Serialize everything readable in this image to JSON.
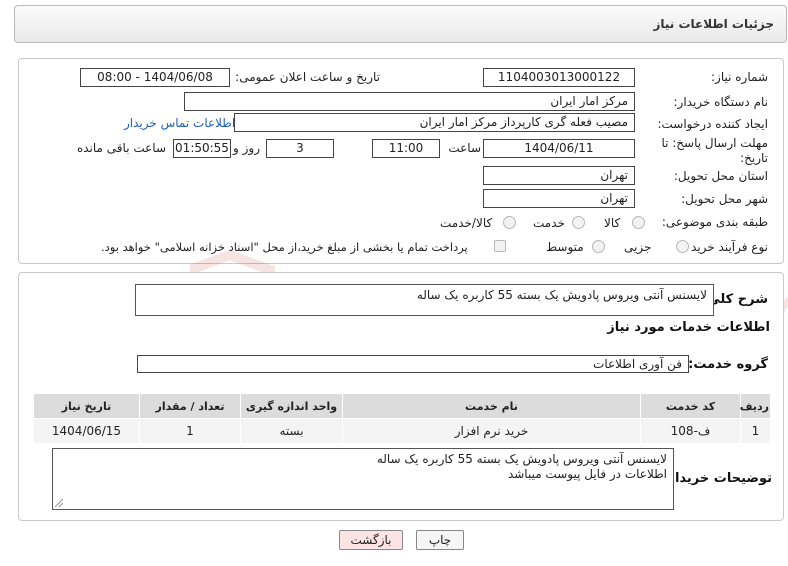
{
  "header": {
    "title": "جزئیات اطلاعات نیاز"
  },
  "form": {
    "need_number_label": "شماره نیاز:",
    "need_number": "1104003013000122",
    "announce_label": "تاریخ و ساعت اعلان عمومی:",
    "announce_value": "1404/06/08 - 08:00",
    "buyer_label": "نام دستگاه خریدار:",
    "buyer_value": "مرکز امار ایران",
    "creator_label": "ایجاد کننده درخواست:",
    "creator_value": "مصیب فعله گری کارپرداز مرکز امار ایران",
    "contact_link": "اطلاعات تماس خریدار",
    "deadline_label": "مهلت ارسال پاسخ: تا تاریخ:",
    "deadline_date": "1404/06/11",
    "time_label": "ساعت",
    "deadline_time": "11:00",
    "days_value": "3",
    "days_label": "روز و",
    "remaining_value": "01:50:55",
    "remaining_label": "ساعت باقی مانده",
    "province_label": "استان محل تحویل:",
    "province_value": "تهران",
    "city_label": "شهر محل تحویل:",
    "city_value": "تهران",
    "category_label": "طبقه بندی موضوعی:",
    "category_options": [
      "کالا",
      "خدمت",
      "کالا/خدمت"
    ],
    "process_label": "نوع فرآیند خرید :",
    "process_options": [
      "جزیی",
      "متوسط"
    ],
    "payment_note": "پرداخت تمام یا بخشی از مبلغ خرید،از محل \"اسناد خزانه اسلامی\" خواهد بود."
  },
  "details": {
    "summary_label": "شرح کلی نیاز:",
    "summary_value": "لایسنس آنتی ویروس پادویش یک بسته 55 کاربره یک ساله",
    "services_heading": "اطلاعات خدمات مورد نیاز",
    "group_label": "گروه خدمت:",
    "group_value": "فن آوری اطلاعات",
    "table": {
      "headers": [
        "ردیف",
        "کد خدمت",
        "نام خدمت",
        "واحد اندازه گیری",
        "تعداد / مقدار",
        "تاریخ نیاز"
      ],
      "rows": [
        [
          "1",
          "ف-108",
          "خرید نرم افزار",
          "بسته",
          "1",
          "1404/06/15"
        ]
      ]
    },
    "buyer_notes_label": "توضیحات خریدار:",
    "buyer_notes_line1": "لایسنس آنتی ویروس پادویش یک بسته 55 کاربره یک ساله",
    "buyer_notes_line2": "اطلاعات در فایل پیوست میباشد"
  },
  "buttons": {
    "print": "چاپ",
    "back": "بازگشت"
  },
  "watermark": {
    "text": "AriaTender.neT"
  },
  "colors": {
    "link": "#1d5fb8",
    "back_button_bg": "#fde4e4",
    "watermark": "#c0392b"
  }
}
